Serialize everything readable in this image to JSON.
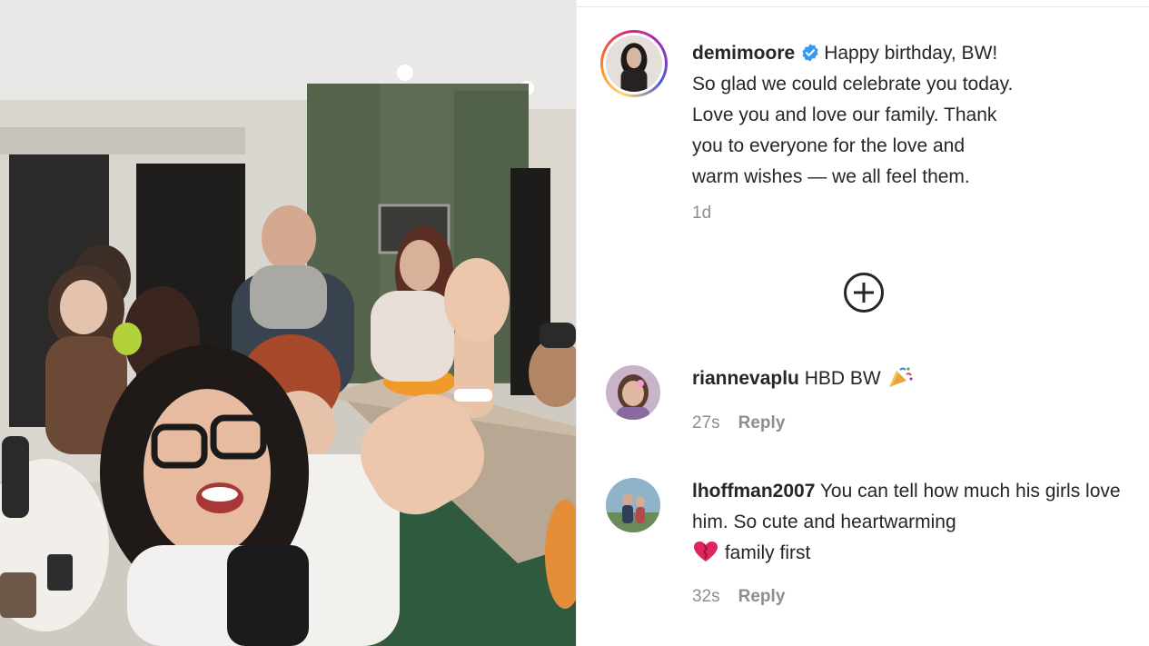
{
  "post": {
    "username": "demimoore",
    "caption": "Happy birthday, BW! So glad we could celebrate you today. Love you and love our family. Thank you to everyone for the love and warm wishes — we all feel them.",
    "caption_lines": [
      "Happy birthday, BW!",
      "So glad we could celebrate you today.",
      "Love you and love our family. Thank",
      "you to everyone for the love and",
      "warm wishes — we all feel them."
    ],
    "time": "1d",
    "verified_icon": "verified-badge-icon",
    "more_comments_icon": "plus-circle-icon"
  },
  "comments": [
    {
      "username": "riannevaplu",
      "text": "HBD BW",
      "emoji": "party-popper",
      "time": "27s",
      "reply_label": "Reply"
    },
    {
      "username": "lhoffman2007",
      "text_before_emoji": "You can tell how much his girls love him. So cute and heartwarming",
      "emoji": "red-heart",
      "text_after_emoji": "family first",
      "time": "32s",
      "reply_label": "Reply"
    }
  ],
  "colors": {
    "text": "#262626",
    "muted": "#8e8e8e",
    "verified": "#3897f0",
    "border": "#efefef"
  }
}
